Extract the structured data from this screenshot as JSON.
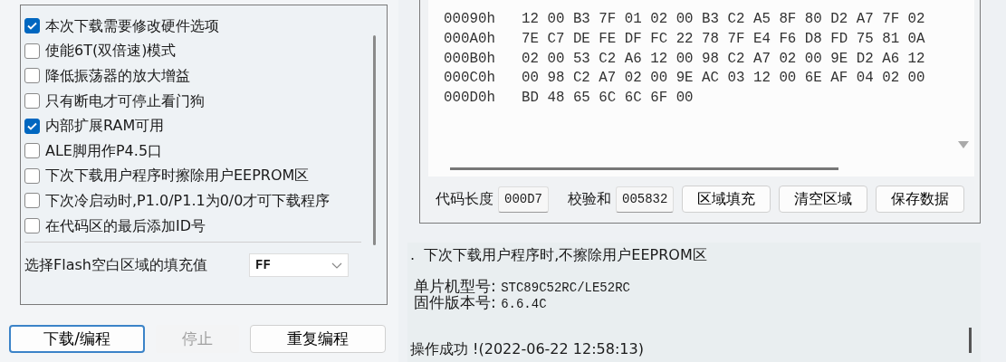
{
  "options": [
    {
      "label": "本次下载需要修改硬件选项",
      "checked": true
    },
    {
      "label": "使能6T(双倍速)模式",
      "checked": false
    },
    {
      "label": "降低振荡器的放大增益",
      "checked": false
    },
    {
      "label": "只有断电才可停止看门狗",
      "checked": false
    },
    {
      "label": "内部扩展RAM可用",
      "checked": true
    },
    {
      "label": "ALE脚用作P4.5口",
      "checked": false
    },
    {
      "label": "下次下载用户程序时擦除用户EEPROM区",
      "checked": false
    },
    {
      "label": "下次冷启动时,P1.0/P1.1为0/0才可下载程序",
      "checked": false
    },
    {
      "label": "在代码区的最后添加ID号",
      "checked": false
    }
  ],
  "fill_setting": {
    "label": "选择Flash空白区域的填充值",
    "value": "FF"
  },
  "action_buttons": [
    {
      "label": "下载/编程",
      "disabled": false
    },
    {
      "label": "停止",
      "disabled": true
    },
    {
      "label": "重复编程",
      "disabled": false
    }
  ],
  "hex_rows": [
    {
      "address": "00090h",
      "bytes": "12 00 B3 7F 01 02 00 B3 C2 A5 8F 80 D2 A7 7F 02"
    },
    {
      "address": "000A0h",
      "bytes": "7E C7 DE FE DF FC 22 78 7F E4 F6 D8 FD 75 81 0A"
    },
    {
      "address": "000B0h",
      "bytes": "02 00 53 C2 A6 12 00 98 C2 A7 02 00 9E D2 A6 12"
    },
    {
      "address": "000C0h",
      "bytes": "00 98 C2 A7 02 00 9E AC 03 12 00 6E AF 04 02 00"
    },
    {
      "address": "000D0h",
      "bytes": "BD 48 65 6C 6C 6F 00"
    }
  ],
  "code_length": {
    "label": "代码长度",
    "value": "000D7"
  },
  "checksum": {
    "label": "校验和",
    "value": "005832"
  },
  "data_buttons": [
    "区域填充",
    "清空区域",
    "保存数据"
  ],
  "log": [
    {
      "kind": "line",
      "text": ".  下次下载用户程序时,不擦除用户EEPROM区"
    },
    {
      "kind": "gap"
    },
    {
      "kind": "field",
      "label": "单片机型号:",
      "value": "STC89C52RC/LE52RC"
    },
    {
      "kind": "field",
      "label": "固件版本号:",
      "value": "6.6.4C"
    },
    {
      "kind": "gap"
    },
    {
      "kind": "gap"
    },
    {
      "kind": "line",
      "text": "操作成功 !(2022-06-22 12:58:13)"
    }
  ]
}
